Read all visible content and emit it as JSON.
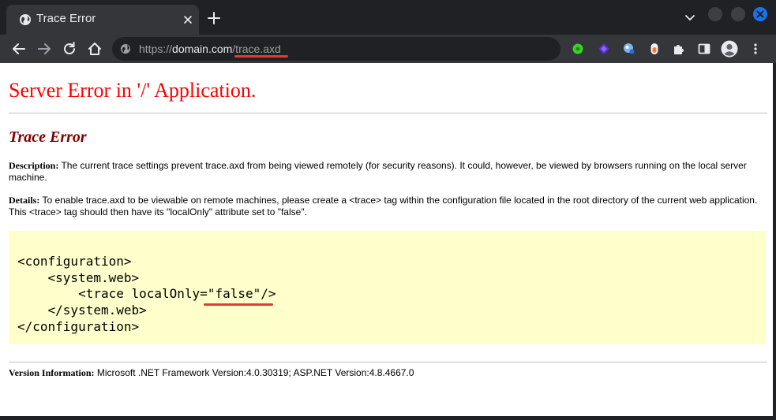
{
  "browser": {
    "tab": {
      "title": "Trace Error",
      "favicon": "globe-icon"
    },
    "url": {
      "scheme": "https://",
      "host": "domain.com",
      "path": "/trace.axd"
    },
    "extensions": [
      "green-extension-icon",
      "purple-extension-icon",
      "blue-extension-icon",
      "orange-extension-icon",
      "puzzle-icon",
      "sidepanel-icon",
      "profile-icon",
      "menu-dots-icon"
    ]
  },
  "page": {
    "title": "Server Error in '/' Application.",
    "subtitle": "Trace Error",
    "description": {
      "label": "Description:",
      "text": " The current trace settings prevent trace.axd from being viewed remotely (for security reasons). It could, however, be viewed by browsers running on the local server machine."
    },
    "details": {
      "label": "Details:",
      "text": " To enable trace.axd to be viewable on remote machines, please create a <trace> tag within the configuration file located in the root directory of the current web application. This <trace> tag should then have its \"localOnly\" attribute set to \"false\"."
    },
    "code": "<configuration>\n    <system.web>\n        <trace localOnly=\"false\"/>\n    </system.web>\n</configuration>",
    "version": {
      "label": "Version Information:",
      "text": " Microsoft .NET Framework Version:4.0.30319; ASP.NET Version:4.8.4667.0"
    }
  },
  "colors": {
    "error_title": "#ff0000",
    "subtitle": "#800000",
    "code_bg": "#ffffcc",
    "annotation": "#e53935"
  }
}
